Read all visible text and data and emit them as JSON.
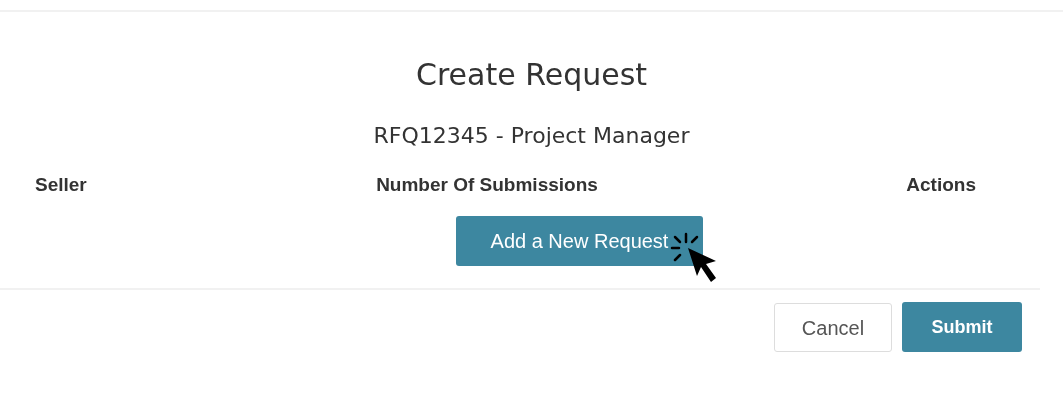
{
  "modal": {
    "title": "Create Request",
    "subtitle": "RFQ12345 - Project Manager"
  },
  "table": {
    "columns": [
      "Seller",
      "Number Of Submissions",
      "Actions"
    ]
  },
  "add_button": {
    "label": "Add a New Request"
  },
  "footer": {
    "buttons": [
      {
        "label": "Cancel",
        "kind": "secondary"
      },
      {
        "label": "Submit",
        "kind": "primary"
      }
    ]
  }
}
